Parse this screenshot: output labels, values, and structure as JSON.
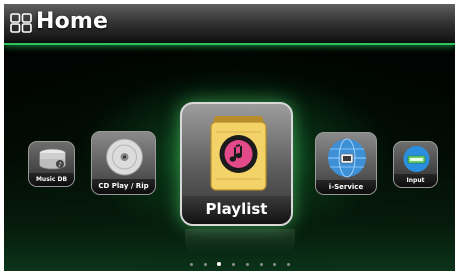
{
  "header": {
    "title": "Home",
    "icon": "home-grid-icon",
    "accent_color": "#2bc45c"
  },
  "menu": {
    "items": [
      {
        "label": "Music DB",
        "icon": "music-db-icon"
      },
      {
        "label": "CD Play / Rip",
        "icon": "cd-disc-icon"
      },
      {
        "label": "Playlist",
        "icon": "playlist-icon",
        "selected": true
      },
      {
        "label": "i-Service",
        "icon": "i-service-icon"
      },
      {
        "label": "Input",
        "icon": "input-icon"
      }
    ]
  },
  "pager": {
    "pages": 8,
    "current": 3
  }
}
